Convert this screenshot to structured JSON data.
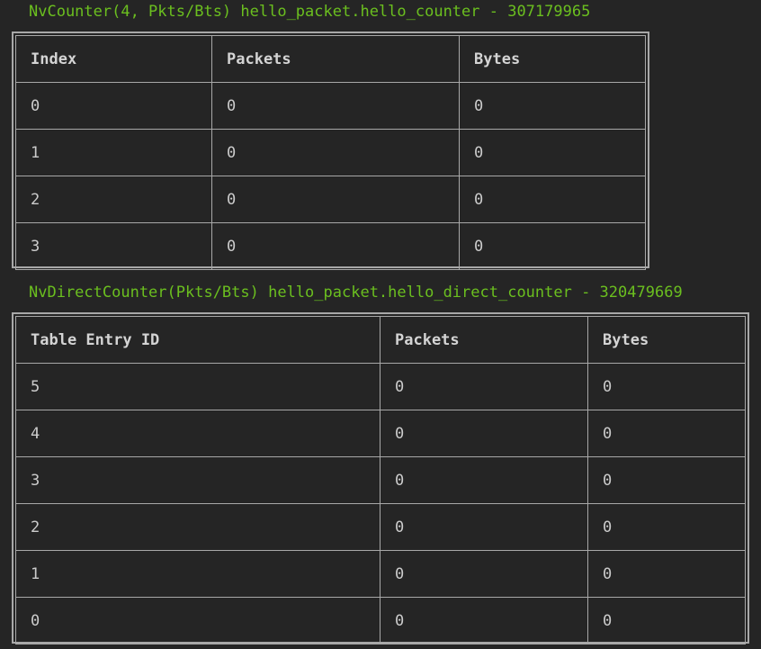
{
  "counter": {
    "title": "NvCounter(4, Pkts/Bts) hello_packet.hello_counter - 307179965",
    "headers": [
      "Index",
      "Packets",
      "Bytes"
    ],
    "rows": [
      [
        "0",
        "0",
        "0"
      ],
      [
        "1",
        "0",
        "0"
      ],
      [
        "2",
        "0",
        "0"
      ],
      [
        "3",
        "0",
        "0"
      ]
    ]
  },
  "direct_counter": {
    "title": "NvDirectCounter(Pkts/Bts) hello_packet.hello_direct_counter - 320479669",
    "headers": [
      "Table Entry ID",
      "Packets",
      "Bytes"
    ],
    "rows": [
      [
        "5",
        "0",
        "0"
      ],
      [
        "4",
        "0",
        "0"
      ],
      [
        "3",
        "0",
        "0"
      ],
      [
        "2",
        "0",
        "0"
      ],
      [
        "1",
        "0",
        "0"
      ],
      [
        "0",
        "0",
        "0"
      ]
    ]
  },
  "colors": {
    "background": "#252525",
    "title_green": "#6bbf1f",
    "border": "#a8a8a8",
    "text": "#cccccc"
  }
}
